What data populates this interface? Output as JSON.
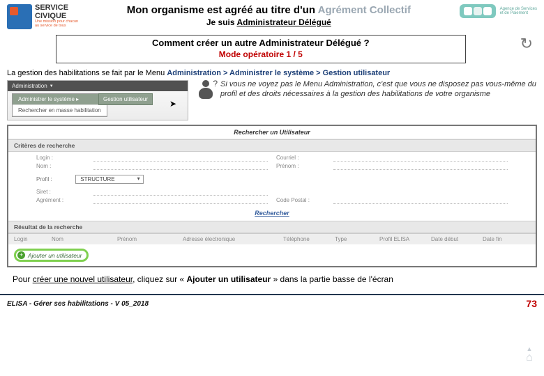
{
  "logo_sc": {
    "line1": "SERVICE",
    "line2": "CIVIQUE",
    "tagline1": "Une mission pour chacun",
    "tagline2": "au service de tous"
  },
  "logo_asp": {
    "line1": "Agence de Services",
    "line2": "et de Paiement"
  },
  "title_main_prefix": "Mon organisme est agréé au titre d'un ",
  "title_main_grey": "Agrément Collectif",
  "title_sub_prefix": "Je suis ",
  "title_sub_role": "Administrateur Délégué",
  "question": "Comment créer un autre Administrateur Délégué ?",
  "mode_label": "Mode opératoire 1 / 5",
  "body_prefix": "La gestion des habilitations se fait par le Menu  ",
  "body_navpath": "Administration >  Administrer le système > Gestion utilisateur",
  "menu": {
    "top": "Administration",
    "item1": "Administrer le système ▸",
    "item2": "Rechercher en masse habilitation",
    "popup": "Gestion utilisateur"
  },
  "tip": "Si vous ne voyez pas le Menu Administration, c'est que vous ne disposez pas vous-même du profil et des droits nécessaires à la gestion des habilitations de votre organisme",
  "form": {
    "title": "Rechercher un Utilisateur",
    "section_criteria": "Critères de recherche",
    "labels": {
      "login": "Login :",
      "courriel": "Courriel :",
      "nom": "Nom :",
      "prenom": "Prénom :",
      "profil": "Profil :",
      "siret": "Siret :",
      "agrement": "Agrément :",
      "codepostal": "Code Postal :"
    },
    "select_value": "STRUCTURE",
    "search": "Rechercher",
    "section_result": "Résultat de la recherche",
    "cols": {
      "login": "Login",
      "nom": "Nom",
      "prenom": "Prénom",
      "email": "Adresse électronique",
      "tel": "Téléphone",
      "type": "Type",
      "profil": "Profil ELISA",
      "date": "Date début",
      "fin": "Date fin"
    },
    "add_user": "Ajouter un utilisateur"
  },
  "instruction_prefix": "Pour ",
  "instruction_uline": "créer une nouvel utilisateur",
  "instruction_mid": ", cliquez sur « ",
  "instruction_bold": "Ajouter un utilisateur",
  "instruction_suffix": " » dans la partie basse de l'écran",
  "footer_left": "ELISA - Gérer ses habilitations - V 05_2018",
  "page_number": "73"
}
